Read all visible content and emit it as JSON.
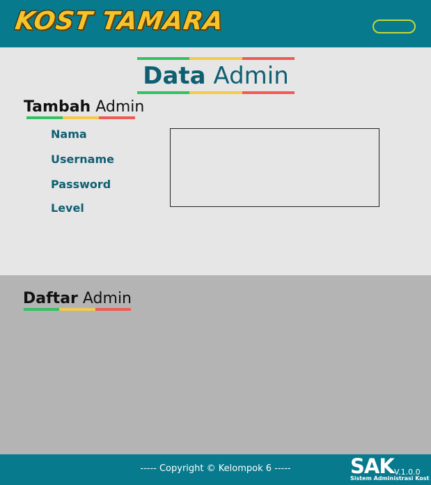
{
  "header": {
    "logo_text": "KOST TAMARA"
  },
  "page": {
    "title_bold": "Data",
    "title_light": "Admin"
  },
  "tambah": {
    "title_bold": "Tambah",
    "title_light": "Admin",
    "fields": [
      "Nama",
      "Username",
      "Password",
      "Level"
    ]
  },
  "daftar": {
    "title_bold": "Daftar",
    "title_light": "Admin"
  },
  "footer": {
    "copyright": "----- Copyright © Kelompok 6 -----",
    "brand": "SAK",
    "version": "V.1.0.0",
    "brand_tagline": "Sistem Administrasi Kost"
  },
  "colors": {
    "header_bg": "#077a8e",
    "accent_green": "#34c064",
    "accent_yellow": "#f5c94a",
    "accent_red": "#f05a55",
    "label_color": "#0f5f72"
  }
}
